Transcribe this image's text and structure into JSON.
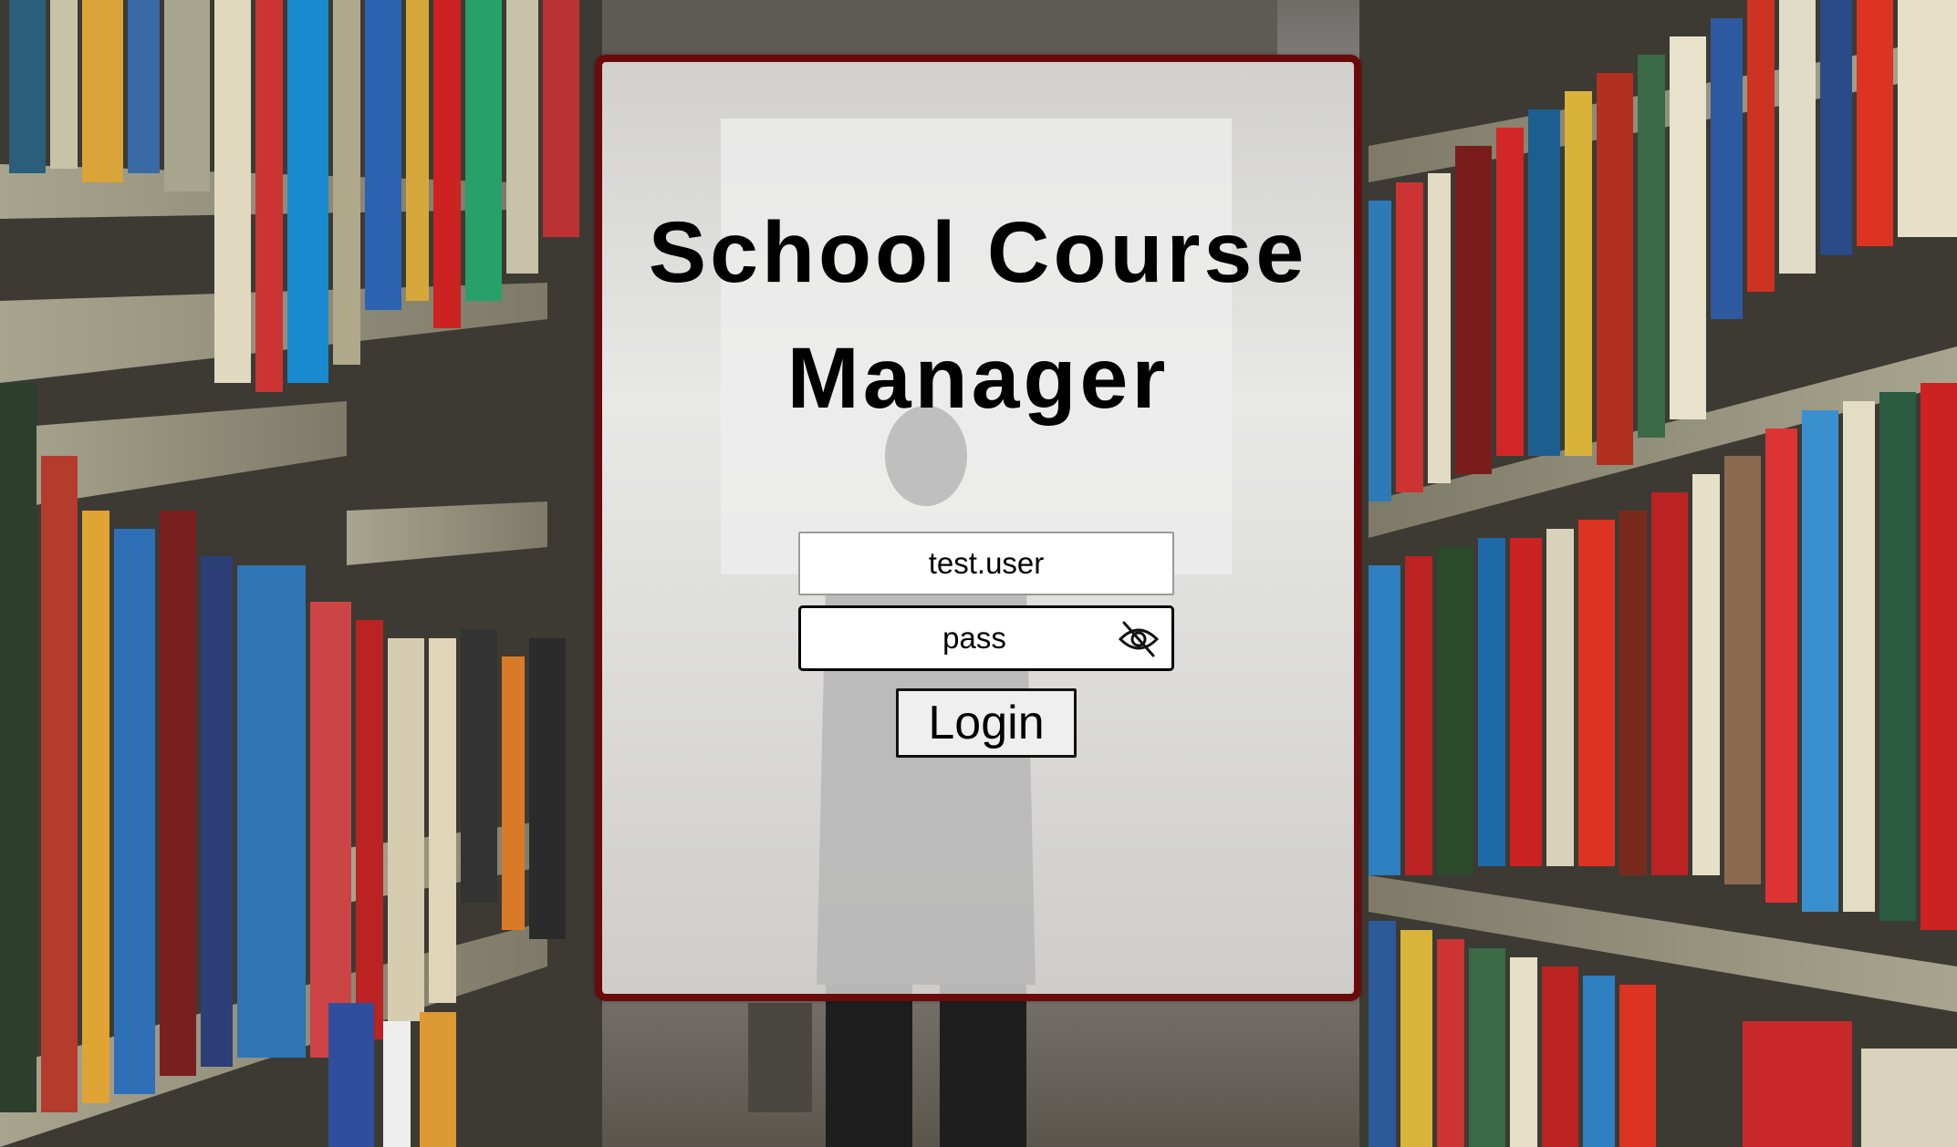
{
  "app": {
    "title": "School Course Manager"
  },
  "login": {
    "username_value": "test.user",
    "password_value": "pass",
    "password_visibility_icon": "eye-off-icon",
    "login_label": "Login"
  },
  "colors": {
    "card_border": "#6b0a0a",
    "card_background": "rgba(238,238,238,0.74)"
  },
  "background": {
    "description_icon": "library-bookshelves-photo"
  }
}
